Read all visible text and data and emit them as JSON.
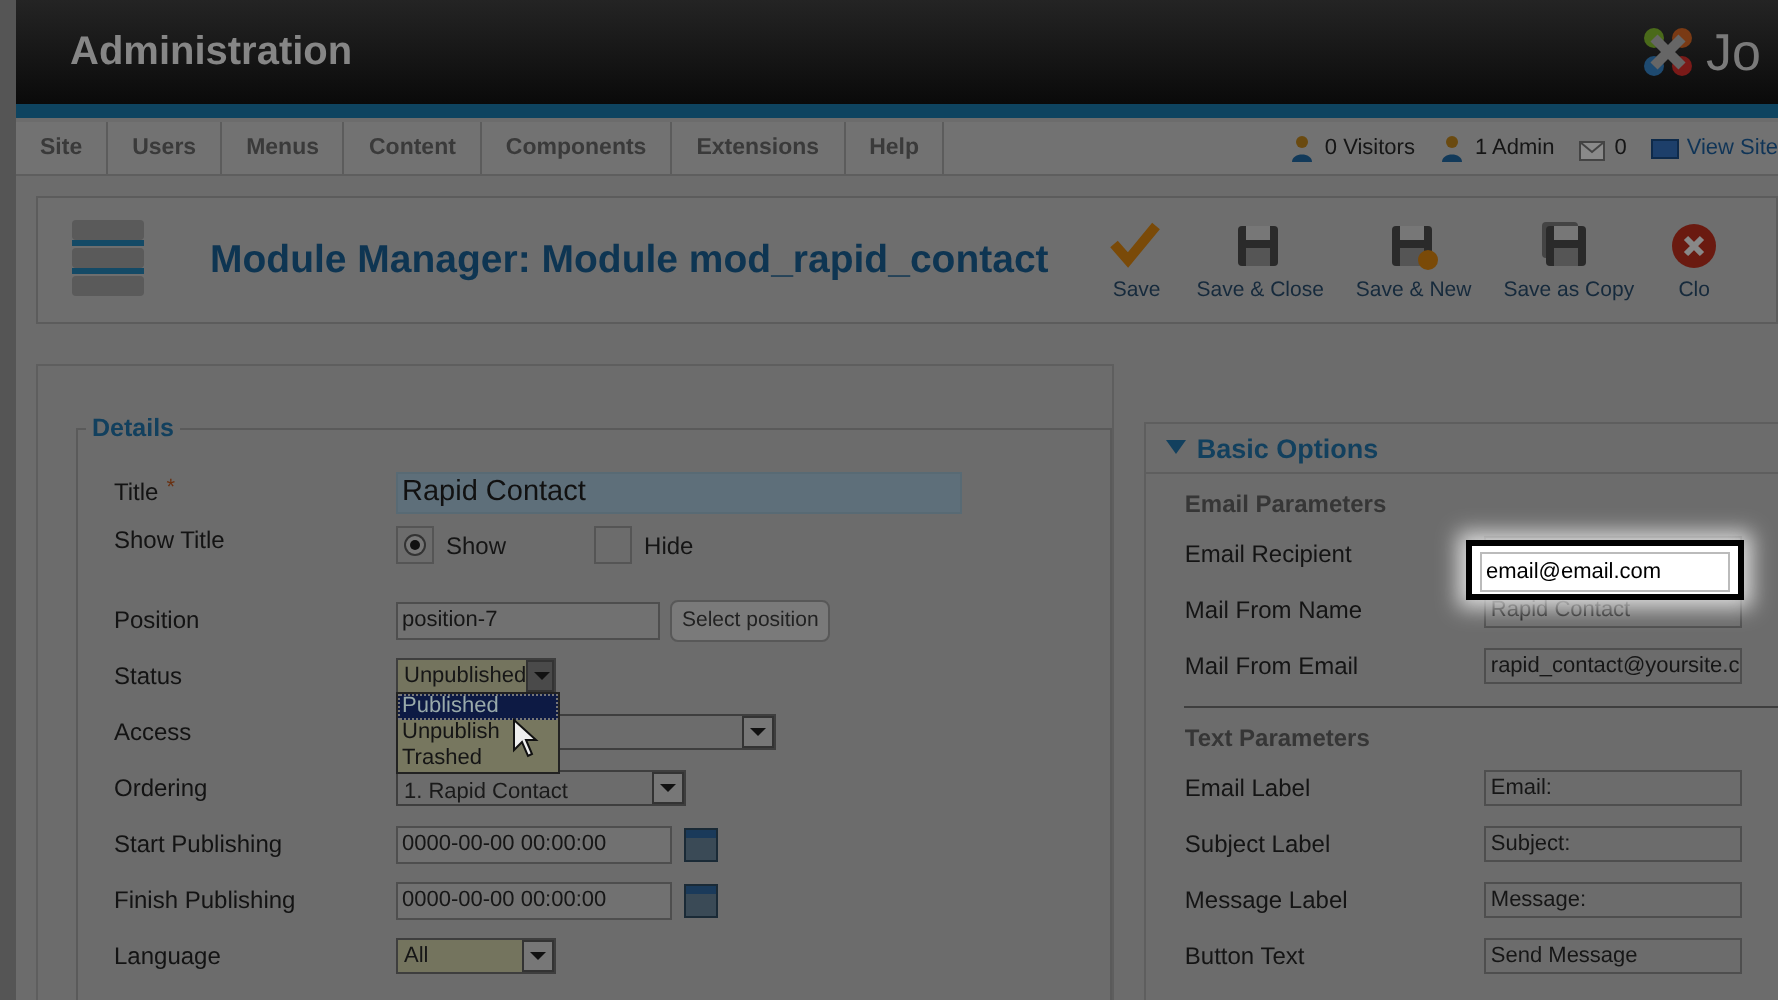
{
  "header": {
    "title": "Administration",
    "logo_text": "Jo"
  },
  "menu": [
    {
      "label": "Site"
    },
    {
      "label": "Users"
    },
    {
      "label": "Menus"
    },
    {
      "label": "Content"
    },
    {
      "label": "Components"
    },
    {
      "label": "Extensions"
    },
    {
      "label": "Help"
    }
  ],
  "status": [
    {
      "kind": "visitors",
      "text": "0 Visitors"
    },
    {
      "kind": "admins",
      "text": "1 Admin"
    },
    {
      "kind": "messages",
      "text": "0"
    },
    {
      "kind": "site",
      "text": "View Site"
    }
  ],
  "toolbar": {
    "title": "Module Manager: Module mod_rapid_contact",
    "buttons": [
      {
        "kind": "save",
        "label": "Save"
      },
      {
        "kind": "save-close",
        "label": "Save & Close"
      },
      {
        "kind": "save-new",
        "label": "Save & New"
      },
      {
        "kind": "save-copy",
        "label": "Save as Copy"
      },
      {
        "kind": "close",
        "label": "Clo"
      }
    ]
  },
  "details": {
    "legend": "Details",
    "fields": [
      {
        "kind": "text",
        "label": "Title",
        "required_mark": "*",
        "value": "Rapid Contact",
        "focused": true
      },
      {
        "kind": "radio",
        "label": "Show Title",
        "options": [
          {
            "label": "Show",
            "selected": true
          },
          {
            "label": "Hide",
            "selected": false
          }
        ]
      },
      {
        "kind": "text",
        "label": "Position",
        "value": "position-7",
        "focused": false,
        "button": "Select position"
      },
      {
        "kind": "select",
        "label": "Status",
        "value": "Unpublished",
        "expanded": true,
        "options": [
          {
            "label": "Published",
            "selected": true
          },
          {
            "label": "Unpublish",
            "selected": false
          },
          {
            "label": "Trashed",
            "selected": false
          }
        ]
      },
      {
        "kind": "select",
        "label": "Access",
        "wide": true,
        "expanded": false
      },
      {
        "kind": "select",
        "label": "Ordering",
        "value": "1. Rapid Contact",
        "medium": true,
        "expanded": false
      },
      {
        "kind": "date",
        "label": "Start Publishing",
        "value": "0000-00-00 00:00:00"
      },
      {
        "kind": "date",
        "label": "Finish Publishing",
        "value": "0000-00-00 00:00:00"
      },
      {
        "kind": "select",
        "label": "Language",
        "value": "All",
        "expanded": false
      }
    ]
  },
  "basic_options": {
    "title": "Basic Options",
    "expanded": true,
    "sections": [
      {
        "heading": "Email Parameters",
        "fields": [
          {
            "label": "Email Recipient"
          },
          {
            "label": "Mail From Name",
            "value": "Rapid Contact"
          },
          {
            "label": "Mail From Email",
            "value": "rapid_contact@yoursite.c"
          }
        ]
      },
      {
        "heading": "Text Parameters",
        "fields": [
          {
            "label": "Email Label",
            "value": "Email:"
          },
          {
            "label": "Subject Label",
            "value": "Subject:"
          },
          {
            "label": "Message Label",
            "value": "Message:"
          },
          {
            "label": "Button Text",
            "value": "Send Message"
          }
        ]
      }
    ]
  },
  "callout": {
    "value": "email@email.com"
  }
}
